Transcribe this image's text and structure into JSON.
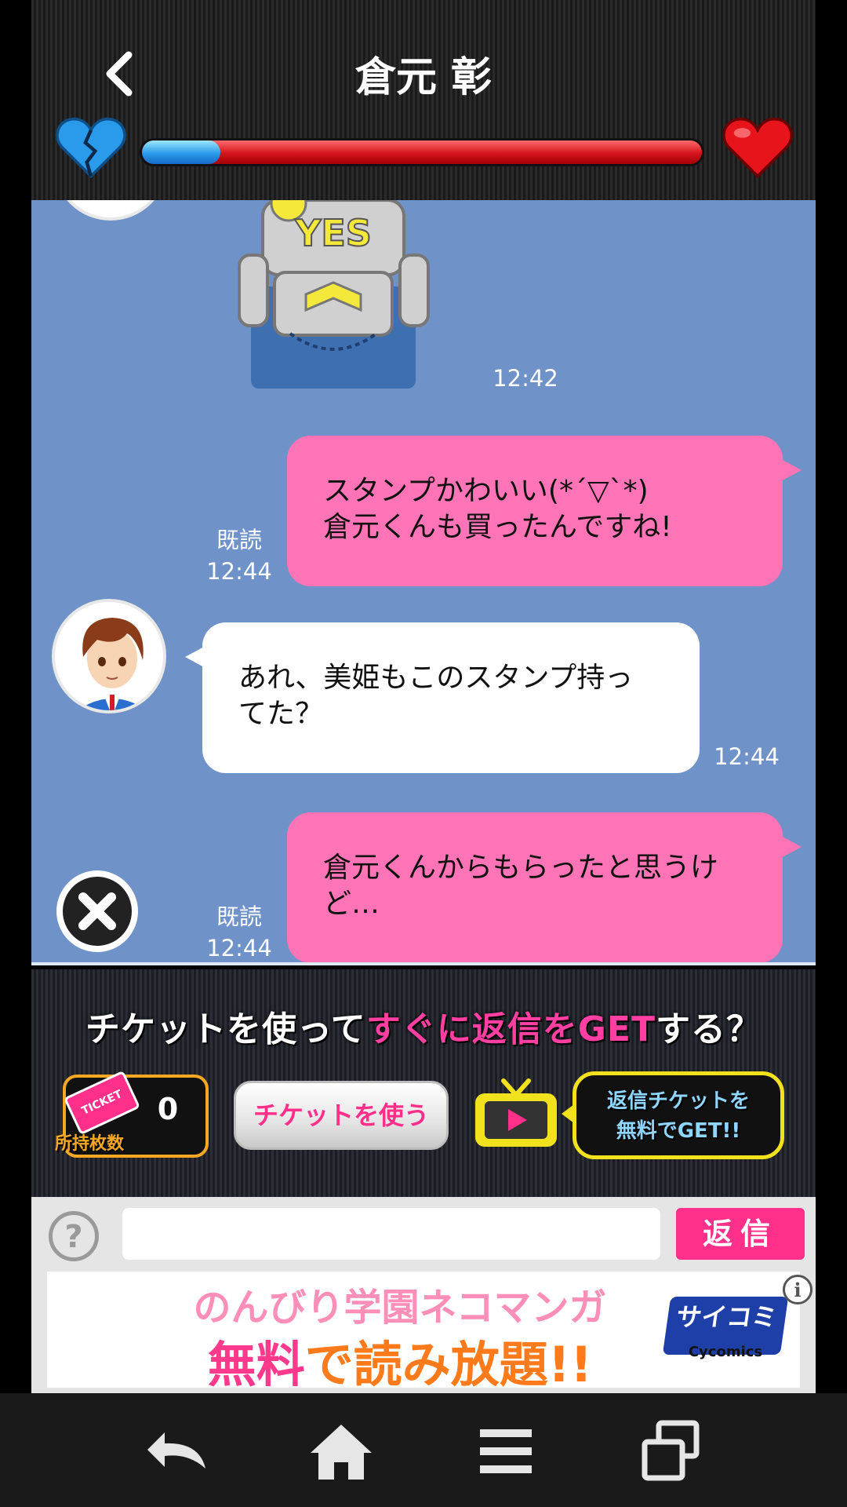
{
  "header": {
    "title": "倉元 彰",
    "back_icon": "chevron-left-icon",
    "affection_level": 0.14,
    "colors": {
      "low": "#2a9bea",
      "high": "#d3141c"
    }
  },
  "chat": {
    "sticker_text": "YES",
    "messages": [
      {
        "side": "left",
        "type": "sticker",
        "time": "12:42"
      },
      {
        "side": "right",
        "text_lines": [
          "スタンプかわいい(*´▽`*)",
          "倉元くんも買ったんですね!"
        ],
        "read": "既読",
        "time": "12:44"
      },
      {
        "side": "left",
        "text_lines": [
          "あれ、美姫もこのスタンプ持っ",
          "てた？"
        ],
        "time": "12:44"
      },
      {
        "side": "right",
        "text_lines": [
          "倉元くんからもらったと思うけ",
          "ど…"
        ],
        "read": "既読",
        "time": "12:44"
      }
    ]
  },
  "ticket_bar": {
    "question_part1": "チケットを使って",
    "question_part2": "すぐに返信をGET",
    "question_part3": "する？",
    "ticket_icon_text": "TICKET",
    "ticket_count": "0",
    "ticket_count_label": "所持枚数",
    "use_ticket_label": "チケットを使う",
    "free_ticket_line1": "返信チケットを",
    "free_ticket_line2": "無料でGET!!"
  },
  "input": {
    "help_label": "?",
    "placeholder": "",
    "send_label": "返信"
  },
  "ad": {
    "line1": "のんびり学園ネコマンガ",
    "line2_part1": "無料",
    "line2_part2": "で読み放題!!",
    "brand": "サイコミ",
    "brand_sub": "Cycomics",
    "info": "i"
  },
  "navbar": {
    "icons": [
      "back-icon",
      "home-icon",
      "menu-icon",
      "recent-apps-icon"
    ]
  }
}
